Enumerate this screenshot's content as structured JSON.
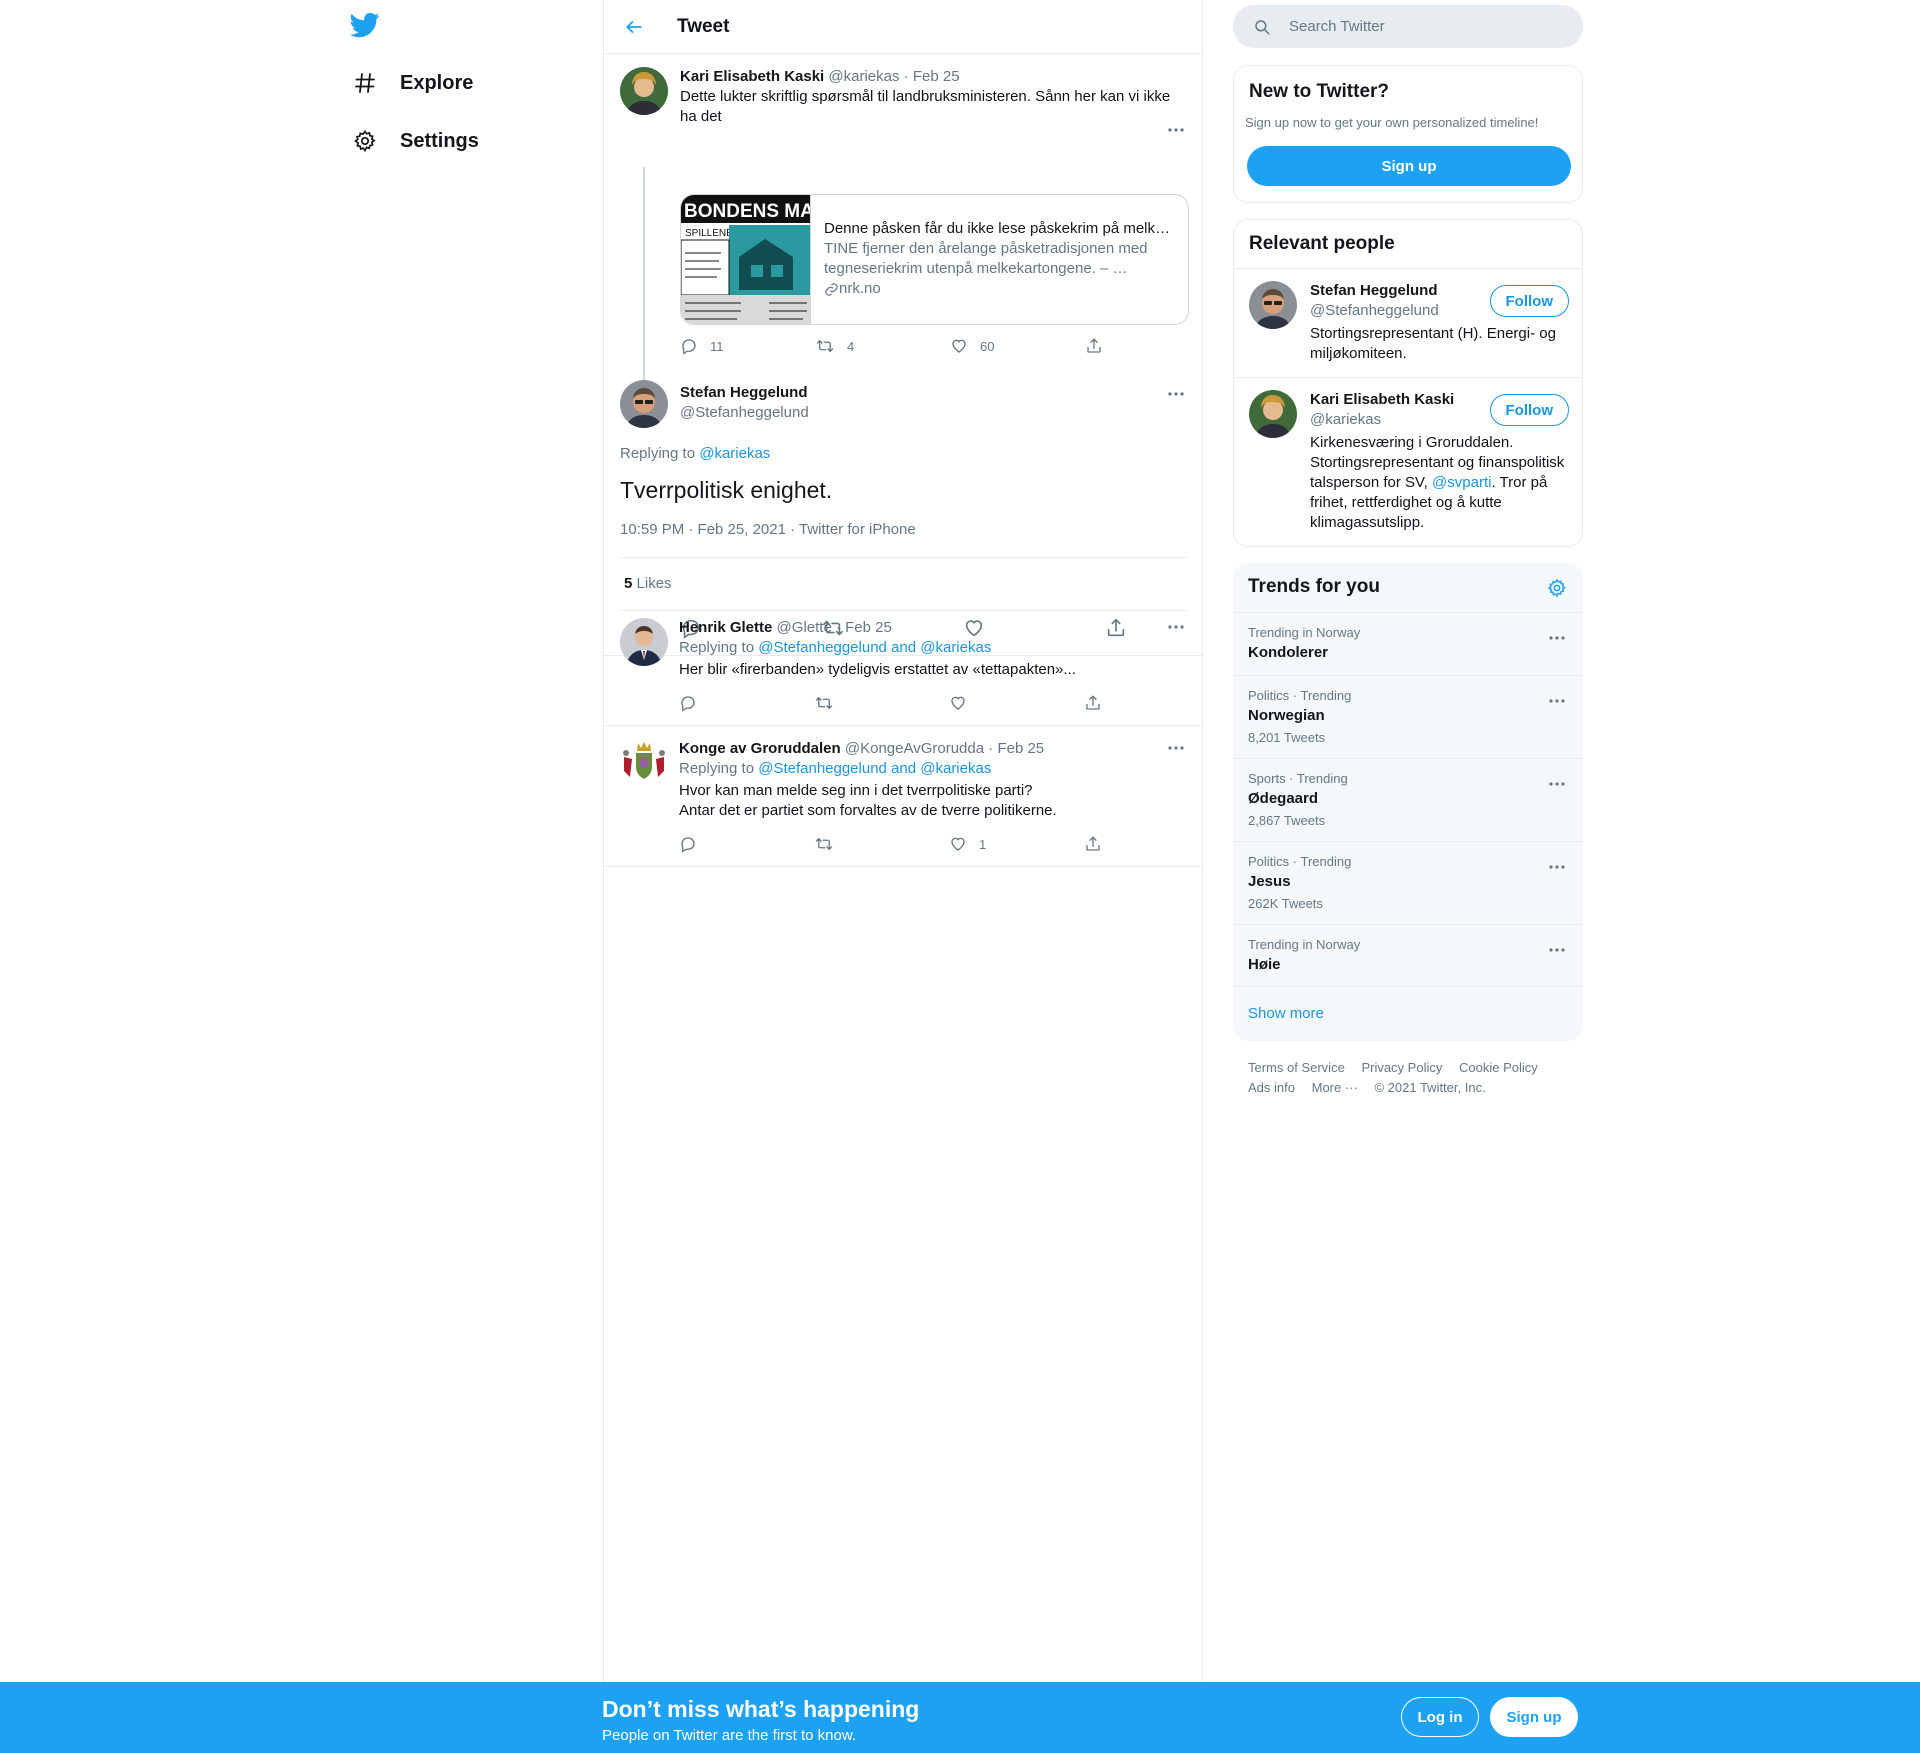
{
  "nav": {
    "explore": "Explore",
    "settings": "Settings"
  },
  "header": {
    "title": "Tweet"
  },
  "tweets": {
    "parent": {
      "name": "Kari Elisabeth Kaski",
      "handle": "@kariekas",
      "sep": "·",
      "date": "Feb 25",
      "line1": "Dette lukter skriftlig spørsmål til landbruksministeren. Sånn her kan vi ikke",
      "line2": "ha det",
      "card": {
        "title": "Denne påsken får du ikke lese påskekrim på melk…",
        "desc": "TINE fjerner den årelange påsketradisjonen med tegneseriekrim utenpå melkekartongene. – …",
        "domain": "nrk.no",
        "image_text": "BONDENS MAND",
        "image_sub": "SPILLENE"
      },
      "replies": "11",
      "retweets": "4",
      "likes": "60"
    },
    "focused": {
      "name": "Stefan Heggelund",
      "handle": "@Stefanheggelund",
      "replying_prefix": "Replying to",
      "replying_to": "@kariekas",
      "text": "Tverrpolitisk enighet.",
      "meta": "10:59 PM · Feb 25, 2021 · Twitter for iPhone",
      "likes_count": "5",
      "likes_label": "Likes"
    },
    "reply1": {
      "name": "Henrik Glette",
      "handle": "@Glette",
      "sep": "·",
      "date": "Feb 25",
      "replying_prefix": "Replying to",
      "replying_to": "@Stefanheggelund and @kariekas",
      "text": "Her blir «firerbanden» tydeligvis erstattet av «tettapakten»...",
      "replies": "",
      "retweets": "",
      "likes": ""
    },
    "reply2": {
      "name": "Konge av Groruddalen",
      "handle": "@KongeAvGrorudda",
      "sep": "·",
      "date": "Feb 25",
      "replying_prefix": "Replying to",
      "replying_to": "@Stefanheggelund and @kariekas",
      "line1": "Hvor kan man melde seg inn i det tverrpolitiske parti?",
      "line2": "Antar det er partiet som forvaltes av de tverre politikerne.",
      "replies": "",
      "retweets": "",
      "likes": "1"
    }
  },
  "search": {
    "placeholder": "Search Twitter"
  },
  "new_to_twitter": {
    "title": "New to Twitter?",
    "subtitle": "Sign up now to get your own personalized timeline!",
    "button": "Sign up"
  },
  "relevant": {
    "title": "Relevant people",
    "people": [
      {
        "name": "Stefan Heggelund",
        "handle": "@Stefanheggelund",
        "bio_line1": "Stortingsrepresentant (H). Energi- og",
        "bio_line2": "miljøkomiteen.",
        "follow": "Follow"
      },
      {
        "name": "Kari Elisabeth Kaski",
        "handle": "@kariekas",
        "bio_line1": "Kirkenesværing i Groruddalen.",
        "bio_line2": "Stortingsrepresentant og finanspolitisk",
        "bio_line3_pre": "talsperson for SV,",
        "bio_mention": "@svparti",
        "bio_line3_post": ". Tror på",
        "bio_line4": "frihet, rettferdighet og å kutte",
        "bio_line5": "klimagassutslipp.",
        "follow": "Follow"
      }
    ]
  },
  "trends": {
    "title": "Trends for you",
    "items": [
      {
        "context": "Trending in Norway",
        "name": "Kondolerer",
        "count": ""
      },
      {
        "context": "Politics · Trending",
        "name": "Norwegian",
        "count": "8,201 Tweets"
      },
      {
        "context": "Sports · Trending",
        "name": "Ødegaard",
        "count": "2,867 Tweets"
      },
      {
        "context": "Politics · Trending",
        "name": "Jesus",
        "count": "262K Tweets"
      },
      {
        "context": "Trending in Norway",
        "name": "Høie",
        "count": ""
      }
    ],
    "show_more": "Show more"
  },
  "footer": {
    "terms": "Terms of Service",
    "privacy": "Privacy Policy",
    "cookie": "Cookie Policy",
    "ads": "Ads info",
    "more": "More ···",
    "copyright": "© 2021 Twitter, Inc."
  },
  "banner": {
    "headline": "Don’t miss what’s happening",
    "sub": "People on Twitter are the first to know.",
    "login": "Log in",
    "signup": "Sign up"
  },
  "colors": {
    "accent": "#1da1f2",
    "link": "#1b95e0",
    "secondary_text": "#657786",
    "border": "#e6ecf0"
  }
}
